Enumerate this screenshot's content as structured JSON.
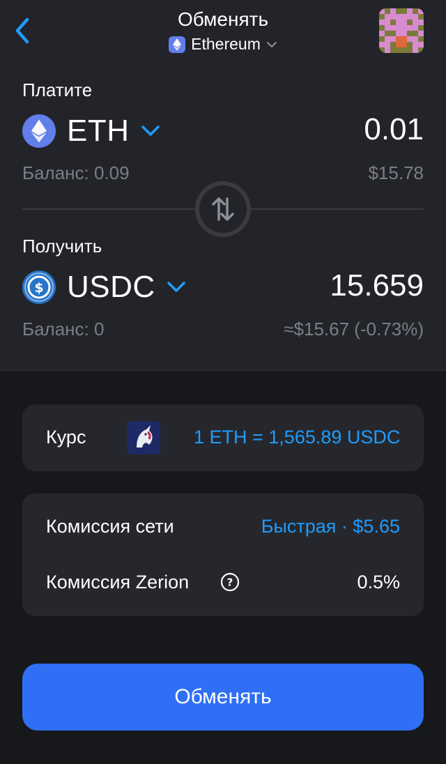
{
  "header": {
    "title": "Обменять",
    "network": "Ethereum",
    "back_icon": "chevron-left-icon",
    "avatar": "pixel-avatar"
  },
  "pay": {
    "label": "Платите",
    "token": "ETH",
    "amount": "0.01",
    "balance": "Баланс: 0.09",
    "usd_value": "$15.78"
  },
  "receive": {
    "label": "Получить",
    "token": "USDC",
    "amount": "15.659",
    "balance": "Баланс: 0",
    "usd_value": "≈$15.67 (-0.73%)"
  },
  "rate": {
    "label": "Курс",
    "value": "1 ETH = 1,565.89 USDC",
    "provider_icon": "1inch-unicorn-icon"
  },
  "fees": {
    "network_label": "Комиссия сети",
    "network_value": "Быстрая · $5.65",
    "zerion_label": "Комиссия Zerion",
    "zerion_value": "0.5%"
  },
  "action": {
    "label": "Обменять"
  },
  "colors": {
    "accent": "#1f9cff",
    "button": "#2f6ff5",
    "eth": "#627eea",
    "usdc": "#2775ca",
    "background": "#17181c",
    "panel": "#232429"
  }
}
